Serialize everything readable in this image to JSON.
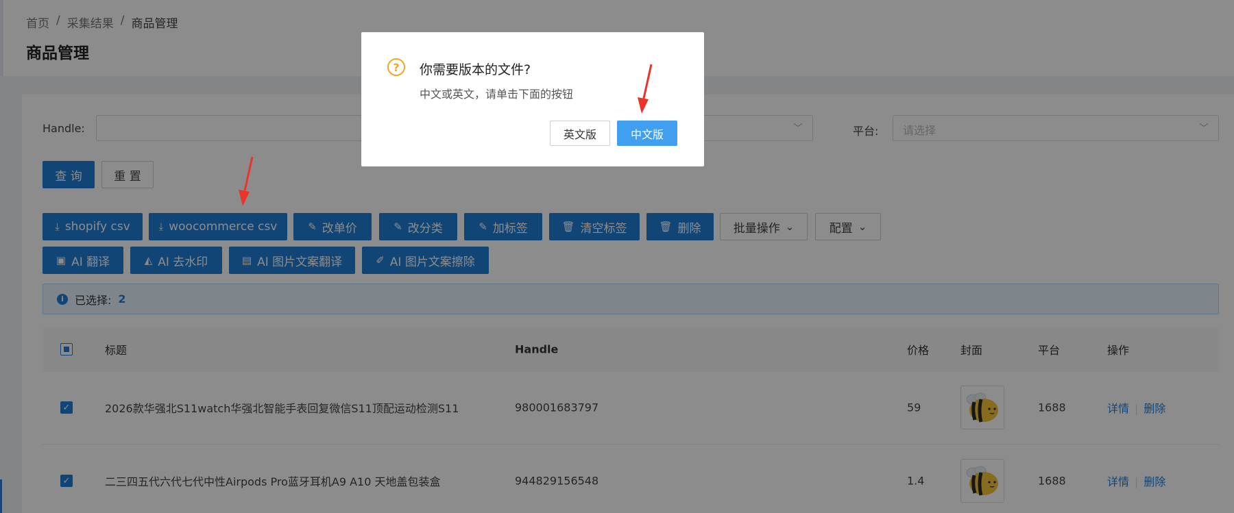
{
  "breadcrumb": {
    "home": "首页",
    "sep": "/",
    "results": "采集结果",
    "current": "商品管理"
  },
  "page_title": "商品管理",
  "filter": {
    "handle_label": "Handle:",
    "platform_label": "平台:",
    "platform_placeholder": "请选择",
    "query_button": "查 询",
    "reset_button": "重 置"
  },
  "toolbar": {
    "row1": [
      {
        "name": "shopify-csv-button",
        "label": "shopify csv",
        "icon": "download-icon",
        "glyph": "⤓"
      },
      {
        "name": "woocommerce-csv-button",
        "label": "woocommerce csv",
        "icon": "download-icon",
        "glyph": "⤓"
      },
      {
        "name": "change-price-button",
        "label": "改单价",
        "icon": "edit-icon",
        "glyph": "✎"
      },
      {
        "name": "change-category-button",
        "label": "改分类",
        "icon": "edit-icon",
        "glyph": "✎"
      },
      {
        "name": "add-tag-button",
        "label": "加标签",
        "icon": "edit-icon",
        "glyph": "✎"
      },
      {
        "name": "clear-tags-button",
        "label": "清空标签",
        "icon": "trash-icon",
        "glyph": "🗑"
      },
      {
        "name": "delete-button",
        "label": "删除",
        "icon": "trash-icon",
        "glyph": "🗑"
      }
    ],
    "batch_label": "批量操作",
    "config_label": "配置",
    "row2": [
      {
        "name": "ai-translate-button",
        "label": "AI 翻译",
        "icon": "translate-icon",
        "glyph": "▣"
      },
      {
        "name": "ai-watermark-button",
        "label": "AI 去水印",
        "icon": "eraser-icon",
        "glyph": "◭"
      },
      {
        "name": "ai-image-translate-button",
        "label": "AI 图片文案翻译",
        "icon": "document-icon",
        "glyph": "▤"
      },
      {
        "name": "ai-image-erase-button",
        "label": "AI 图片文案擦除",
        "icon": "brush-icon",
        "glyph": "✐"
      }
    ]
  },
  "selection": {
    "label": "已选择:",
    "count": "2"
  },
  "table": {
    "headers": {
      "title": "标题",
      "handle": "Handle",
      "price": "价格",
      "cover": "封面",
      "platform": "平台",
      "actions": "操作"
    },
    "rows": [
      {
        "title": "2026款华强北S11watch华强北智能手表回复微信S11顶配运动检测S11",
        "handle": "980001683797",
        "price": "59",
        "platform": "1688",
        "detail": "详情",
        "delete": "删除"
      },
      {
        "title": "二三四五代六代七代中性Airpods Pro蓝牙耳机A9 A10 天地盖包装盒",
        "handle": "944829156548",
        "price": "1.4",
        "platform": "1688",
        "detail": "详情",
        "delete": "删除"
      }
    ]
  },
  "dialog": {
    "title": "你需要版本的文件?",
    "message": "中文或英文，请单击下面的按钮",
    "english_button": "英文版",
    "chinese_button": "中文版"
  },
  "colors": {
    "primary": "#1f7fd6",
    "dialog_primary": "#40a0ef",
    "warning": "#f5a623",
    "arrow": "#e8352b"
  }
}
